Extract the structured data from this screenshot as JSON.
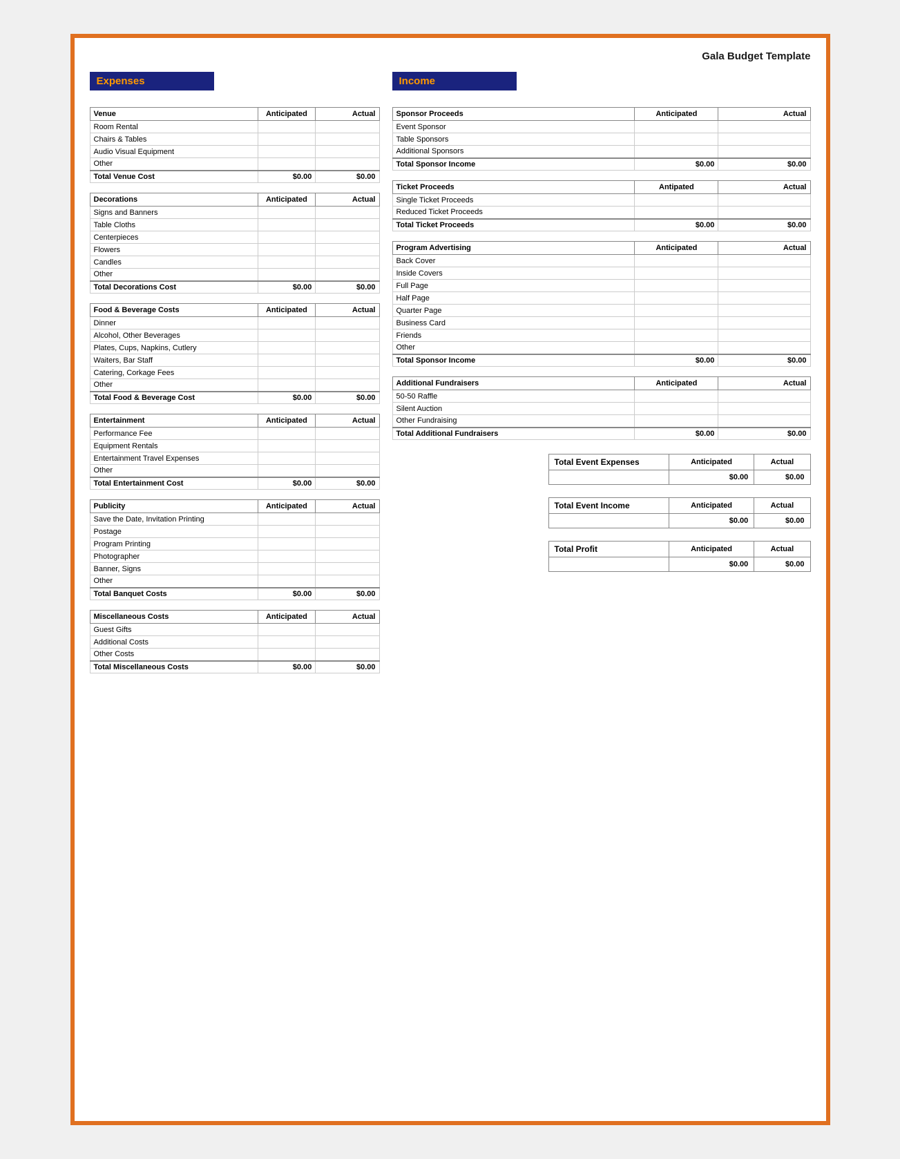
{
  "title": "Gala Budget Template",
  "sections": {
    "expenses_header": "Expenses",
    "income_header": "Income"
  },
  "expenses": {
    "venue": {
      "header": "Venue",
      "col_anticipated": "Anticipated",
      "col_actual": "Actual",
      "rows": [
        "Room Rental",
        "Chairs & Tables",
        "Audio Visual Equipment",
        "Other"
      ],
      "total_label": "Total Venue Cost",
      "total_anticipated": "$0.00",
      "total_actual": "$0.00"
    },
    "decorations": {
      "header": "Decorations",
      "col_anticipated": "Anticipated",
      "col_actual": "Actual",
      "rows": [
        "Signs and Banners",
        "Table Cloths",
        "Centerpieces",
        "Flowers",
        "Candles",
        "Other"
      ],
      "total_label": "Total Decorations Cost",
      "total_anticipated": "$0.00",
      "total_actual": "$0.00"
    },
    "food_beverage": {
      "header": "Food & Beverage Costs",
      "col_anticipated": "Anticipated",
      "col_actual": "Actual",
      "rows": [
        "Dinner",
        "Alcohol, Other Beverages",
        "Plates, Cups, Napkins, Cutlery",
        "Waiters, Bar Staff",
        "Catering, Corkage Fees",
        "Other"
      ],
      "total_label": "Total Food & Beverage Cost",
      "total_anticipated": "$0.00",
      "total_actual": "$0.00"
    },
    "entertainment": {
      "header": "Entertainment",
      "col_anticipated": "Anticipated",
      "col_actual": "Actual",
      "rows": [
        "Performance Fee",
        "Equipment Rentals",
        "Entertainment Travel Expenses",
        "Other"
      ],
      "total_label": "Total Entertainment Cost",
      "total_anticipated": "$0.00",
      "total_actual": "$0.00"
    },
    "publicity": {
      "header": "Publicity",
      "col_anticipated": "Anticipated",
      "col_actual": "Actual",
      "rows": [
        "Save the Date, Invitation Printing",
        "Postage",
        "Program Printing",
        "Photographer",
        "Banner, Signs",
        "Other"
      ],
      "total_label": "Total Banquet Costs",
      "total_anticipated": "$0.00",
      "total_actual": "$0.00"
    },
    "miscellaneous": {
      "header": "Miscellaneous Costs",
      "col_anticipated": "Anticipated",
      "col_actual": "Actual",
      "rows": [
        "Guest Gifts",
        "Additional Costs",
        "Other Costs"
      ],
      "total_label": "Total Miscellaneous Costs",
      "total_anticipated": "$0.00",
      "total_actual": "$0.00"
    }
  },
  "income": {
    "sponsor": {
      "header": "Sponsor Proceeds",
      "col_anticipated": "Anticipated",
      "col_actual": "Actual",
      "rows": [
        "Event Sponsor",
        "Table Sponsors",
        "Additional Sponsors"
      ],
      "total_label": "Total Sponsor Income",
      "total_anticipated": "$0.00",
      "total_actual": "$0.00"
    },
    "ticket": {
      "header": "Ticket Proceeds",
      "col_anticipated": "Antipated",
      "col_actual": "Actual",
      "rows": [
        "Single Ticket Proceeds",
        "Reduced Ticket Proceeds"
      ],
      "total_label": "Total Ticket Proceeds",
      "total_anticipated": "$0.00",
      "total_actual": "$0.00"
    },
    "advertising": {
      "header": "Program Advertising",
      "col_anticipated": "Anticipated",
      "col_actual": "Actual",
      "rows": [
        "Back Cover",
        "Inside Covers",
        "Full Page",
        "Half Page",
        "Quarter Page",
        "Business Card",
        "Friends",
        "Other"
      ],
      "total_label": "Total Sponsor Income",
      "total_anticipated": "$0.00",
      "total_actual": "$0.00"
    },
    "fundraisers": {
      "header": "Additional Fundraisers",
      "col_anticipated": "Anticipated",
      "col_actual": "Actual",
      "rows": [
        "50-50 Raffle",
        "Silent Auction",
        "Other Fundraising"
      ],
      "total_label": "Total Additional Fundraisers",
      "total_anticipated": "$0.00",
      "total_actual": "$0.00"
    }
  },
  "summary": {
    "total_expenses": {
      "label": "Total Event Expenses",
      "col_anticipated": "Anticipated",
      "col_actual": "Actual",
      "val_anticipated": "$0.00",
      "val_actual": "$0.00"
    },
    "total_income": {
      "label": "Total Event Income",
      "col_anticipated": "Anticipated",
      "col_actual": "Actual",
      "val_anticipated": "$0.00",
      "val_actual": "$0.00"
    },
    "total_profit": {
      "label": "Total Profit",
      "col_anticipated": "Anticipated",
      "col_actual": "Actual",
      "val_anticipated": "$0.00",
      "val_actual": "$0.00"
    }
  }
}
